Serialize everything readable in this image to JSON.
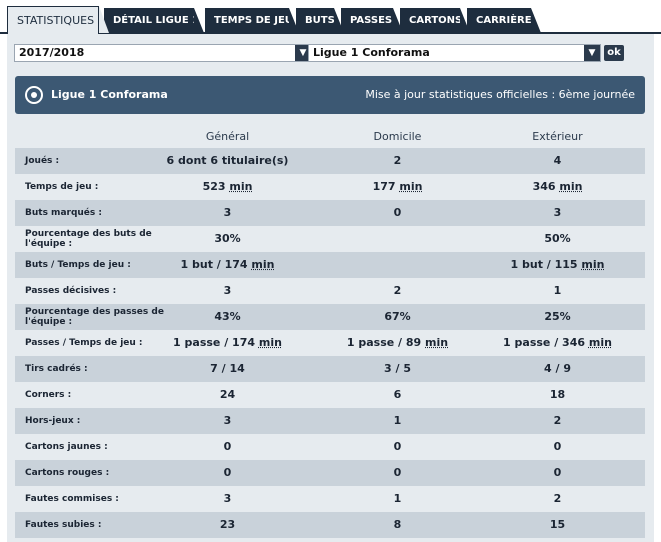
{
  "tabs": [
    {
      "label": "STATISTIQUES",
      "active": true
    },
    {
      "label": "DÉTAIL LIGUE 1"
    },
    {
      "label": "TEMPS DE JEU"
    },
    {
      "label": "BUTS"
    },
    {
      "label": "PASSES"
    },
    {
      "label": "CARTONS"
    },
    {
      "label": "CARRIÈRE"
    }
  ],
  "filters": {
    "season": "2017/2018",
    "competition": "Ligue 1 Conforama",
    "ok_label": "ok"
  },
  "header": {
    "league": "Ligue 1 Conforama",
    "update": "Mise à jour statistiques officielles : 6ème journée"
  },
  "columns": [
    "Général",
    "Domicile",
    "Extérieur"
  ],
  "rows": [
    {
      "label": "Joués :",
      "values": [
        "6 dont 6 titulaire(s)",
        "2",
        "4"
      ]
    },
    {
      "label": "Temps de jeu :",
      "values": [
        "523 min",
        "177 min",
        "346 min"
      ]
    },
    {
      "label": "Buts marqués :",
      "values": [
        "3",
        "0",
        "3"
      ]
    },
    {
      "label": "Pourcentage des buts de l'équipe :",
      "values": [
        "30%",
        "",
        "50%"
      ]
    },
    {
      "label": "Buts / Temps de jeu :",
      "values": [
        "1 but / 174 min",
        "",
        "1 but / 115 min"
      ]
    },
    {
      "label": "Passes décisives :",
      "values": [
        "3",
        "2",
        "1"
      ]
    },
    {
      "label": "Pourcentage des passes de l'équipe :",
      "values": [
        "43%",
        "67%",
        "25%"
      ]
    },
    {
      "label": "Passes / Temps de jeu :",
      "values": [
        "1 passe / 174 min",
        "1 passe / 89 min",
        "1 passe / 346 min"
      ]
    },
    {
      "label": "Tirs cadrés :",
      "values": [
        "7 / 14",
        "3 / 5",
        "4 / 9"
      ]
    },
    {
      "label": "Corners :",
      "values": [
        "24",
        "6",
        "18"
      ]
    },
    {
      "label": "Hors-jeux :",
      "values": [
        "3",
        "1",
        "2"
      ]
    },
    {
      "label": "Cartons jaunes :",
      "values": [
        "0",
        "0",
        "0"
      ]
    },
    {
      "label": "Cartons rouges :",
      "values": [
        "0",
        "0",
        "0"
      ]
    },
    {
      "label": "Fautes commises :",
      "values": [
        "3",
        "1",
        "2"
      ]
    },
    {
      "label": "Fautes subies :",
      "values": [
        "23",
        "8",
        "15"
      ]
    }
  ]
}
